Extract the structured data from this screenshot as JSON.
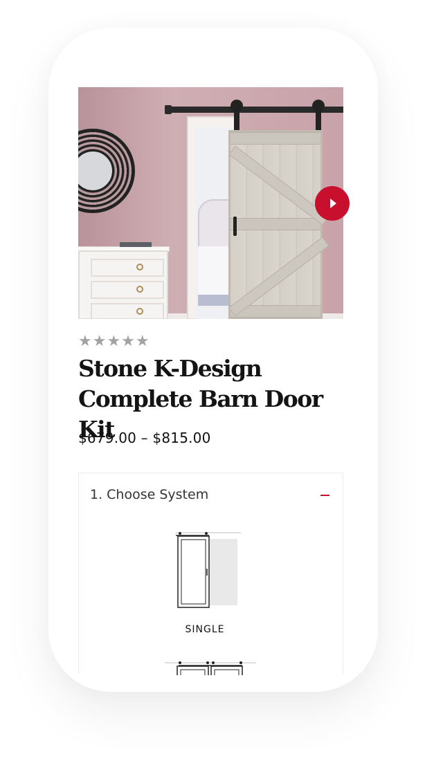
{
  "product": {
    "rating_stars": "★★★★★",
    "title": "Stone K-Design Complete Barn Door Kit",
    "price": "$679.00 – $815.00"
  },
  "gallery": {
    "next_icon": "play-right-icon",
    "accent_color": "#c8102e"
  },
  "configurator": {
    "section_title": "1. Choose System",
    "collapse_icon": "minus-icon",
    "options": [
      {
        "label": "SINGLE",
        "icon": "single-door-icon"
      },
      {
        "label": "",
        "icon": "double-door-icon"
      }
    ]
  }
}
